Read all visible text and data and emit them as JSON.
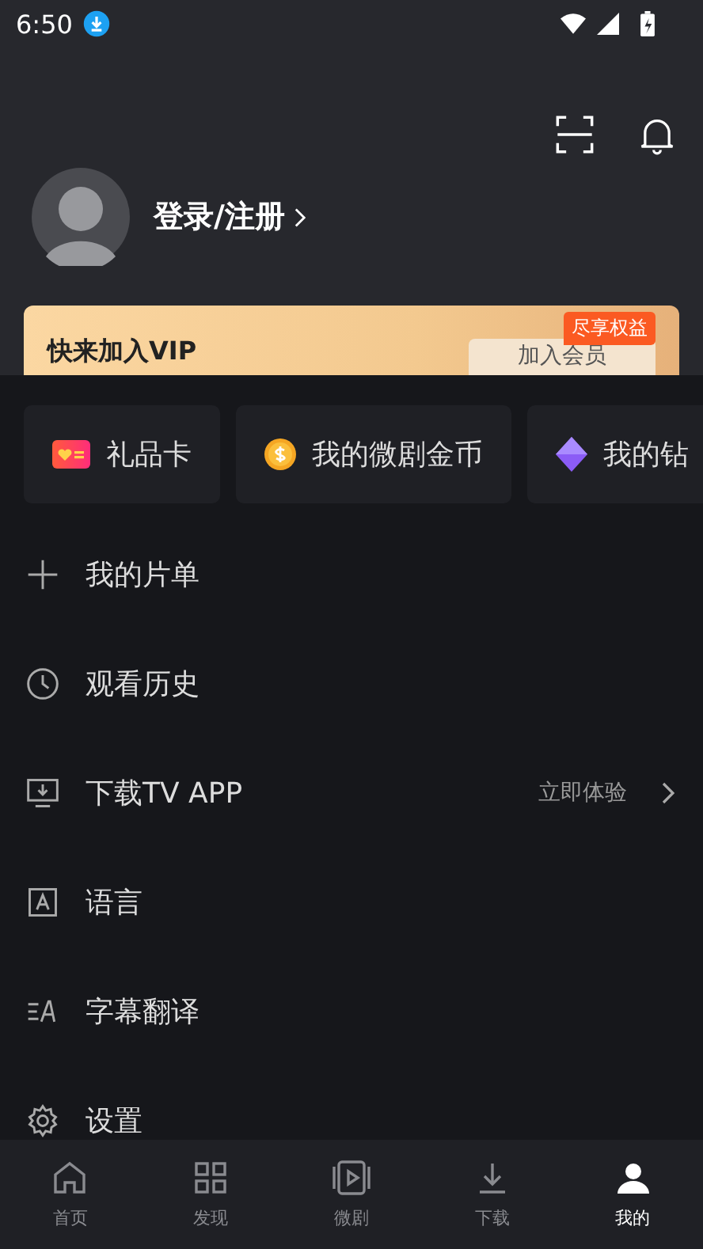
{
  "status_bar": {
    "time": "6:50"
  },
  "profile": {
    "login": "登录/注册"
  },
  "vip_banner": {
    "title": "快来加入VIP",
    "badge": "尽享权益",
    "button": "加入会员"
  },
  "wallet_cards": [
    {
      "kind": "gift",
      "label": "礼品卡"
    },
    {
      "kind": "coin",
      "label": "我的微剧金币"
    },
    {
      "kind": "diamond",
      "label": "我的钻"
    }
  ],
  "menu": [
    {
      "kind": "plus",
      "label": "我的片单"
    },
    {
      "kind": "clock",
      "label": "观看历史"
    },
    {
      "kind": "tv",
      "label": "下载TV APP",
      "hint": "立即体验"
    },
    {
      "kind": "language",
      "label": "语言"
    },
    {
      "kind": "subtitle",
      "label": "字幕翻译"
    },
    {
      "kind": "gear",
      "label": "设置"
    }
  ],
  "bottom_nav": [
    {
      "kind": "home",
      "label": "首页",
      "selected": false
    },
    {
      "kind": "discover",
      "label": "发现",
      "selected": false
    },
    {
      "kind": "short",
      "label": "微剧",
      "selected": false
    },
    {
      "kind": "download",
      "label": "下载",
      "selected": false
    },
    {
      "kind": "me",
      "label": "我的",
      "selected": true
    }
  ]
}
